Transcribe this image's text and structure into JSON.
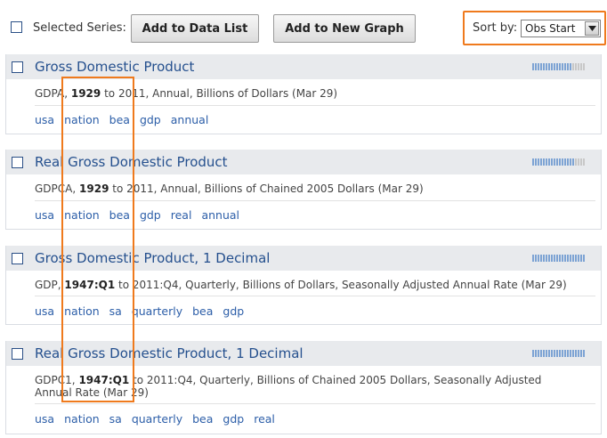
{
  "toolbar": {
    "selected_series_label": "Selected Series:",
    "add_to_data_list_label": "Add to Data List",
    "add_to_new_graph_label": "Add to New Graph",
    "sort_label": "Sort by:",
    "sort_value": "Obs Start"
  },
  "series": [
    {
      "title": "Gross Domestic Product",
      "id": "GDPA",
      "start": "1929",
      "rest": " to 2011, Annual, Billions of Dollars (Mar 29)",
      "rest2": "",
      "tags": [
        "usa",
        "nation",
        "bea",
        "gdp",
        "annual"
      ],
      "popularity": 0.75
    },
    {
      "title": "Real Gross Domestic Product",
      "id": "GDPCA",
      "start": "1929",
      "rest": " to 2011, Annual, Billions of Chained 2005 Dollars (Mar 29)",
      "rest2": "",
      "tags": [
        "usa",
        "nation",
        "bea",
        "gdp",
        "real",
        "annual"
      ],
      "popularity": 0.8
    },
    {
      "title": "Gross Domestic Product, 1 Decimal",
      "id": "GDP",
      "start": "1947:Q1",
      "rest": " to 2011:Q4, Quarterly, Billions of Dollars, Seasonally Adjusted Annual Rate (Mar 29)",
      "rest2": "",
      "tags": [
        "usa",
        "nation",
        "sa",
        "quarterly",
        "bea",
        "gdp"
      ],
      "popularity": 1.0
    },
    {
      "title": "Real Gross Domestic Product, 1 Decimal",
      "id": "GDPC1",
      "start": "1947:Q1",
      "rest": " to 2011:Q4, Quarterly, Billions of Chained 2005 Dollars, Seasonally Adjusted",
      "rest2": "Annual Rate (Mar 29)",
      "tags": [
        "usa",
        "nation",
        "sa",
        "quarterly",
        "bea",
        "gdp",
        "real"
      ],
      "popularity": 1.0
    }
  ],
  "colors": {
    "highlight": "#ef7a1d",
    "link": "#2c5ea8",
    "title": "#25508e"
  }
}
